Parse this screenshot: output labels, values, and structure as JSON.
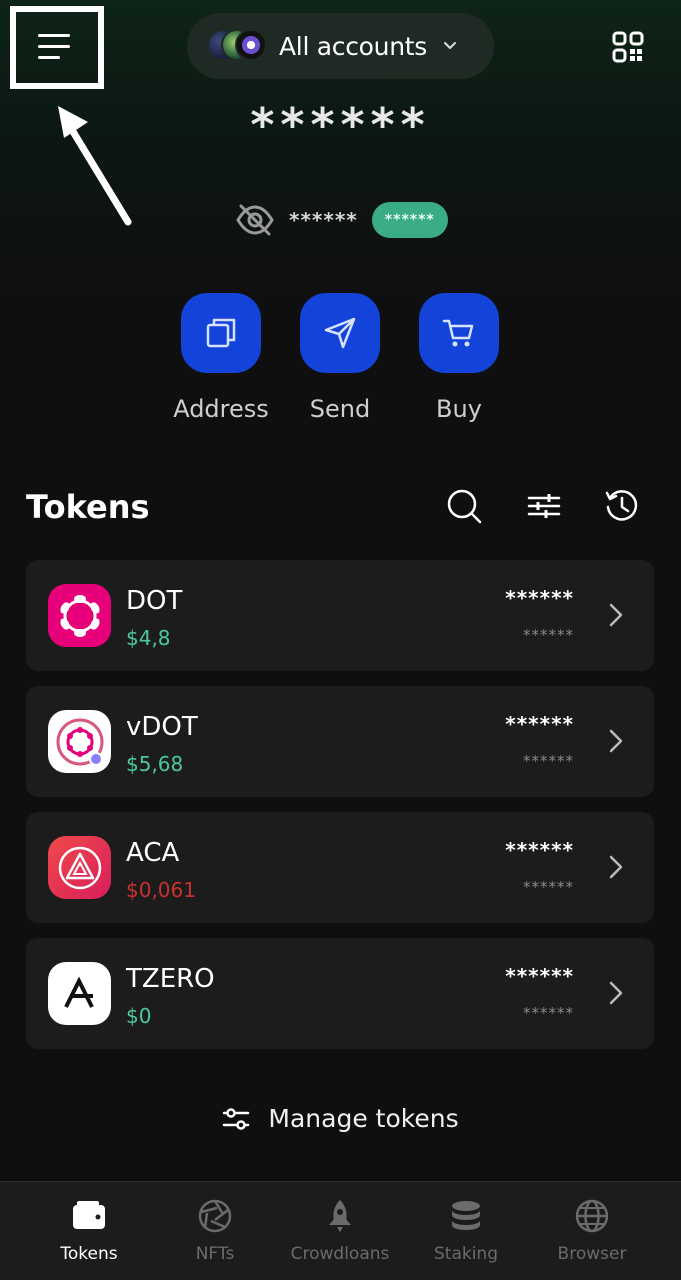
{
  "header": {
    "account_selector": "All accounts",
    "total_balance": "******"
  },
  "summary": {
    "hidden_value": "******",
    "change_badge": "******"
  },
  "actions": {
    "address": "Address",
    "send": "Send",
    "buy": "Buy"
  },
  "tokens_section": {
    "title": "Tokens"
  },
  "tokens": [
    {
      "symbol": "DOT",
      "price": "$4,8",
      "amount": "******",
      "fiat": "******",
      "trend": "up"
    },
    {
      "symbol": "vDOT",
      "price": "$5,68",
      "amount": "******",
      "fiat": "******",
      "trend": "up"
    },
    {
      "symbol": "ACA",
      "price": "$0,061",
      "amount": "******",
      "fiat": "******",
      "trend": "down"
    },
    {
      "symbol": "TZERO",
      "price": "$0",
      "amount": "******",
      "fiat": "******",
      "trend": "up"
    }
  ],
  "manage_tokens": "Manage tokens",
  "bottom_nav": {
    "tokens": "Tokens",
    "nfts": "NFTs",
    "crowdloans": "Crowdloans",
    "staking": "Staking",
    "browser": "Browser"
  },
  "colors": {
    "accent_blue": "#1343d8",
    "positive": "#4cc99c",
    "negative": "#c9312f",
    "badge_green": "#3aad86",
    "dot_pink": "#e6007a",
    "aca_red": "#e8334a"
  }
}
